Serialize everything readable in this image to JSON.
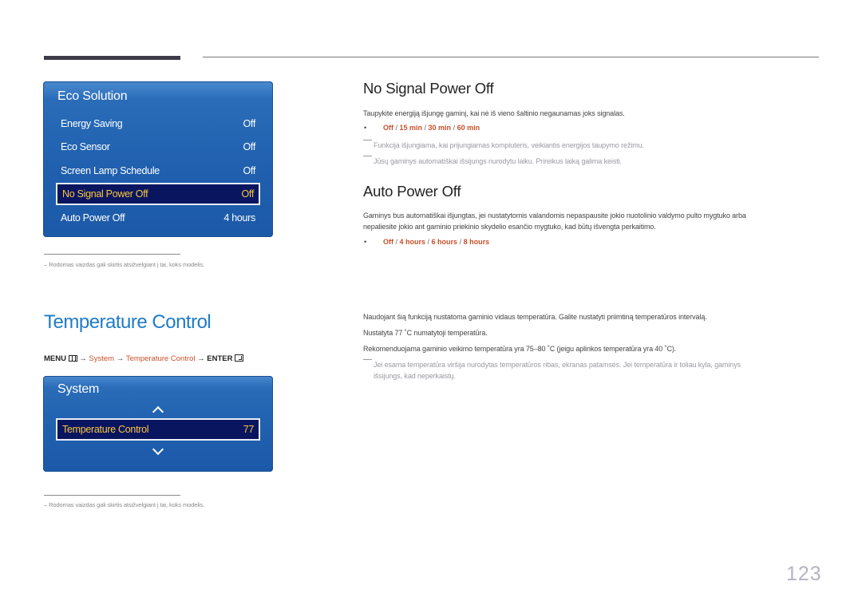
{
  "eco_panel": {
    "title": "Eco Solution",
    "items": [
      {
        "label": "Energy Saving",
        "value": "Off"
      },
      {
        "label": "Eco Sensor",
        "value": "Off"
      },
      {
        "label": "Screen Lamp Schedule",
        "value": "Off"
      },
      {
        "label": "No Signal Power Off",
        "value": "Off",
        "selected": true
      },
      {
        "label": "Auto Power Off",
        "value": "4 hours"
      }
    ]
  },
  "footnote1": "Rodomas vaizdas gali skirtis atsižvelgiant į tai, koks modelis.",
  "no_signal": {
    "heading": "No Signal Power Off",
    "description": "Taupykite energiją išjungę gaminį, kai nė iš vieno šaltinio negaunamas joks signalas.",
    "options": [
      "Off",
      "15 min",
      "30 min",
      "60 min"
    ],
    "notes": [
      "Funkcija išjungiama, kai prijungiamas kompiuteris, veikiantis energijos taupymo režimu.",
      "Jūsų gaminys automatiškai išsijungs nurodytu laiku. Prireikus laiką galima keisti."
    ]
  },
  "auto_power": {
    "heading": "Auto Power Off",
    "description_line1": "Gaminys bus automatiškai išjungtas, jei nustatytomis valandomis nepaspausite jokio nuotolinio valdymo pulto mygtuko arba",
    "description_line2": "nepaliesite jokio ant gaminio priekinio skydelio esančio mygtuko, kad būtų išvengta perkaitimo.",
    "options": [
      "Off",
      "4 hours",
      "6 hours",
      "8 hours"
    ]
  },
  "temperature": {
    "title": "Temperature Control",
    "menu_path": {
      "menu": "MENU",
      "arrow": "→",
      "system": "System",
      "item": "Temperature Control",
      "enter": "ENTER"
    },
    "panel": {
      "title": "System",
      "item_label": "Temperature Control",
      "item_value": "77"
    },
    "paragraphs": [
      "Naudojant šią funkciją nustatoma gaminio vidaus temperatūra. Galite nustatyti priimtiną temperatūros intervalą.",
      "Nustatyta 77 ˚C numatytoji temperatūra.",
      "Rekomenduojama gaminio veikimo temperatūra yra 75–80 ˚C (jeigu aplinkos temperatūra yra 40 ˚C)."
    ],
    "note_line1": "Jei esama temperatūra viršija nurodytas temperatūros ribas, ekranas patamsės. Jei temperatūra ir toliau kyla, gaminys",
    "note_line2": "išsijungs, kad neperkaistų."
  },
  "footnote2": "Rodomas vaizdas gali skirtis atsižvelgiant į tai, koks modelis.",
  "page_number": "123",
  "colors": {
    "accent_orange": "#c8502a",
    "title_blue": "#1f7bc8",
    "osd_blue": "#1f5fae",
    "selected_bg": "#0a1560",
    "selected_text": "#f7c73e"
  }
}
